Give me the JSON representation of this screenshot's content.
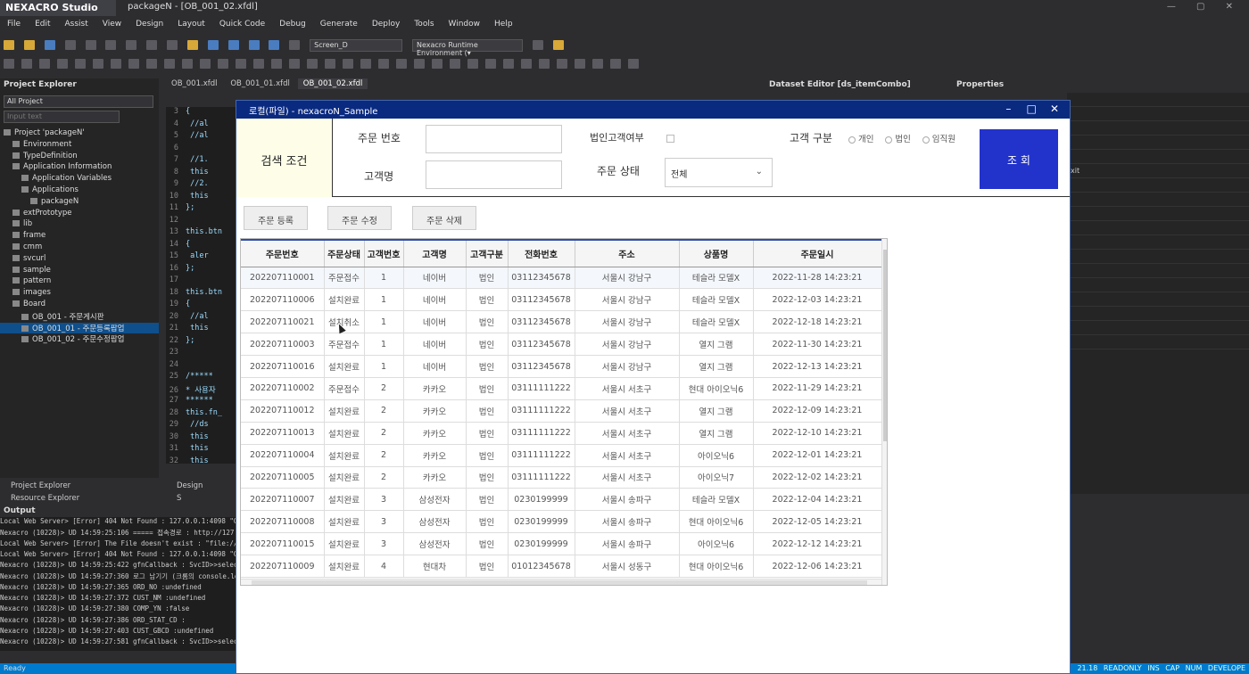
{
  "app": {
    "logo": "NEXACRO Studio",
    "window_title": "packageN - [OB_001_02.xfdl]"
  },
  "menu": [
    "File",
    "Edit",
    "Assist",
    "View",
    "Design",
    "Layout",
    "Quick Code",
    "Debug",
    "Generate",
    "Deploy",
    "Tools",
    "Window",
    "Help"
  ],
  "toolbar": {
    "screen_select": "Screen_D",
    "runtime_select": "Nexacro Runtime Environment (▾"
  },
  "project_explorer": {
    "title": "Project Explorer",
    "filter_value": "All Project",
    "search_placeholder": "Input text",
    "tree": [
      {
        "label": "Project 'packageN'",
        "indent": 0
      },
      {
        "label": "Environment",
        "indent": 1
      },
      {
        "label": "TypeDefinition",
        "indent": 1
      },
      {
        "label": "Application Information",
        "indent": 1
      },
      {
        "label": "Application Variables",
        "indent": 2
      },
      {
        "label": "Applications",
        "indent": 2
      },
      {
        "label": "packageN",
        "indent": 3
      },
      {
        "label": "extPrototype",
        "indent": 1
      },
      {
        "label": "lib",
        "indent": 1
      },
      {
        "label": "frame",
        "indent": 1
      },
      {
        "label": "cmm",
        "indent": 1
      },
      {
        "label": "svcurl",
        "indent": 1
      },
      {
        "label": "sample",
        "indent": 1
      },
      {
        "label": "pattern",
        "indent": 1
      },
      {
        "label": "images",
        "indent": 1
      },
      {
        "label": "Board",
        "indent": 1
      },
      {
        "label": "OB_001 - 주문게시판",
        "indent": 2
      },
      {
        "label": "OB_001_01 - 주문등록팝업",
        "indent": 2,
        "selected": true
      },
      {
        "label": "OB_001_02 - 주문수정팝업",
        "indent": 2
      }
    ],
    "tabs": [
      "Project Explorer",
      "Resource Explorer"
    ]
  },
  "editor": {
    "tabs": [
      "OB_001.xfdl",
      "OB_001_01.xfdl",
      "OB_001_02.xfdl"
    ],
    "lines": [
      {
        "n": "3",
        "code": "{"
      },
      {
        "n": "4",
        "code": "  //al"
      },
      {
        "n": "5",
        "code": "  //al"
      },
      {
        "n": "6",
        "code": ""
      },
      {
        "n": "7",
        "code": "  //1."
      },
      {
        "n": "8",
        "code": "  this"
      },
      {
        "n": "9",
        "code": "  //2."
      },
      {
        "n": "10",
        "code": "  this"
      },
      {
        "n": "11",
        "code": "};"
      },
      {
        "n": "12",
        "code": ""
      },
      {
        "n": "13",
        "code": "this.btn"
      },
      {
        "n": "14",
        "code": "{"
      },
      {
        "n": "15",
        "code": "  aler"
      },
      {
        "n": "16",
        "code": "};"
      },
      {
        "n": "17",
        "code": ""
      },
      {
        "n": "18",
        "code": "this.btn"
      },
      {
        "n": "19",
        "code": "{"
      },
      {
        "n": "20",
        "code": "  //al"
      },
      {
        "n": "21",
        "code": "  this"
      },
      {
        "n": "22",
        "code": "};"
      },
      {
        "n": "23",
        "code": ""
      },
      {
        "n": "24",
        "code": ""
      },
      {
        "n": "25",
        "code": "/*****"
      },
      {
        "n": "26",
        "code": "* 사용자"
      },
      {
        "n": "27",
        "code": "******"
      },
      {
        "n": "28",
        "code": "this.fn_"
      },
      {
        "n": "29",
        "code": "  //ds"
      },
      {
        "n": "30",
        "code": "  this"
      },
      {
        "n": "31",
        "code": "  this"
      },
      {
        "n": "32",
        "code": "  this"
      }
    ],
    "bottom_tabs": [
      "Design",
      "S"
    ]
  },
  "dataset_editor": {
    "title": "Dataset Editor [ds_itemCombo]"
  },
  "properties": {
    "title": "Properties",
    "rows": [
      "",
      "",
      "",
      "",
      "",
      "xit",
      "",
      "",
      "",
      "",
      "",
      "",
      "",
      "",
      "",
      "",
      "",
      ""
    ]
  },
  "output": {
    "title": "Output",
    "lines": [
      "Local Web Server> [Error] 404 Not Found : 127.0.0.1:4098 \"GET /",
      "Nexacro (10228)> UD 14:59:25:106 ===== 접속경로 : http://127.",
      "Local Web Server> [Error] The File doesn't exist : \"file://C:/Dev/e",
      "Local Web Server> [Error] 404 Not Found : 127.0.0.1:4098 \"GET /",
      "Nexacro (10228)> UD 14:59:25:422 gfnCallback : SvcID>>selectO",
      "Nexacro (10228)> UD 14:59:27:360 로그 남기기 (크롬의 console.lo",
      "Nexacro (10228)> UD 14:59:27:365 ORD_NO      :undefined",
      "Nexacro (10228)> UD 14:59:27:372 CUST_NM     :undefined",
      "Nexacro (10228)> UD 14:59:27:380 COMP_YN     :false",
      "Nexacro (10228)> UD 14:59:27:386 ORD_STAT_CD :",
      "Nexacro (10228)> UD 14:59:27:403 CUST_GBCD   :undefined",
      "Nexacro (10228)> UD 14:59:27:581 gfnCallback : SvcID>>selectO"
    ]
  },
  "statusbar": {
    "left": "Ready",
    "right": "21.18   READONLY   INS   CAP   NUM   DEVELOPE"
  },
  "modal": {
    "title": "로컬(파일) - nexacroN_Sample",
    "search_label": "검색 조건",
    "order_no_label": "주문 번호",
    "order_no_value": "",
    "customer_name_label": "고객명",
    "customer_name_value": "",
    "corporate_label": "법인고객여부",
    "corporate_checked": false,
    "order_status_label": "주문 상태",
    "order_status_value": "전체",
    "customer_type_label": "고객 구분",
    "customer_type_options": [
      "개인",
      "법인",
      "임직원"
    ],
    "search_button": "조 회",
    "buttons": [
      "주문 등록",
      "주문 수정",
      "주문 삭제"
    ],
    "grid": {
      "columns": [
        "주문번호",
        "주문상태",
        "고객번호",
        "고객명",
        "고객구분",
        "전화번호",
        "주소",
        "상품명",
        "주문일시"
      ],
      "rows": [
        [
          "202207110001",
          "주문접수",
          "1",
          "네이버",
          "법인",
          "03112345678",
          "서울시 강남구",
          "테슬라 모델X",
          "2022-11-28 14:23:21"
        ],
        [
          "202207110006",
          "설치완료",
          "1",
          "네이버",
          "법인",
          "03112345678",
          "서울시 강남구",
          "테슬라 모델X",
          "2022-12-03 14:23:21"
        ],
        [
          "202207110021",
          "설치취소",
          "1",
          "네이버",
          "법인",
          "03112345678",
          "서울시 강남구",
          "테슬라 모델X",
          "2022-12-18 14:23:21"
        ],
        [
          "202207110003",
          "주문접수",
          "1",
          "네이버",
          "법인",
          "03112345678",
          "서울시 강남구",
          "열지 그램",
          "2022-11-30 14:23:21"
        ],
        [
          "202207110016",
          "설치완료",
          "1",
          "네이버",
          "법인",
          "03112345678",
          "서울시 강남구",
          "열지 그램",
          "2022-12-13 14:23:21"
        ],
        [
          "202207110002",
          "주문접수",
          "2",
          "카카오",
          "법인",
          "03111111222",
          "서울시 서초구",
          "현대 아이오닉6",
          "2022-11-29 14:23:21"
        ],
        [
          "202207110012",
          "설치완료",
          "2",
          "카카오",
          "법인",
          "03111111222",
          "서울시 서초구",
          "열지 그램",
          "2022-12-09 14:23:21"
        ],
        [
          "202207110013",
          "설치완료",
          "2",
          "카카오",
          "법인",
          "03111111222",
          "서울시 서초구",
          "열지 그램",
          "2022-12-10 14:23:21"
        ],
        [
          "202207110004",
          "설치완료",
          "2",
          "카카오",
          "법인",
          "03111111222",
          "서울시 서초구",
          "아이오닉6",
          "2022-12-01 14:23:21"
        ],
        [
          "202207110005",
          "설치완료",
          "2",
          "카카오",
          "법인",
          "03111111222",
          "서울시 서초구",
          "아이오닉7",
          "2022-12-02 14:23:21"
        ],
        [
          "202207110007",
          "설치완료",
          "3",
          "삼성전자",
          "법인",
          "0230199999",
          "서울시 송파구",
          "테슬라 모델X",
          "2022-12-04 14:23:21"
        ],
        [
          "202207110008",
          "설치완료",
          "3",
          "삼성전자",
          "법인",
          "0230199999",
          "서울시 송파구",
          "현대 아이오닉6",
          "2022-12-05 14:23:21"
        ],
        [
          "202207110015",
          "설치완료",
          "3",
          "삼성전자",
          "법인",
          "0230199999",
          "서울시 송파구",
          "아이오닉6",
          "2022-12-12 14:23:21"
        ],
        [
          "202207110009",
          "설치완료",
          "4",
          "현대차",
          "법인",
          "01012345678",
          "서울시 성동구",
          "현대 아이오닉6",
          "2022-12-06 14:23:21"
        ]
      ]
    }
  }
}
